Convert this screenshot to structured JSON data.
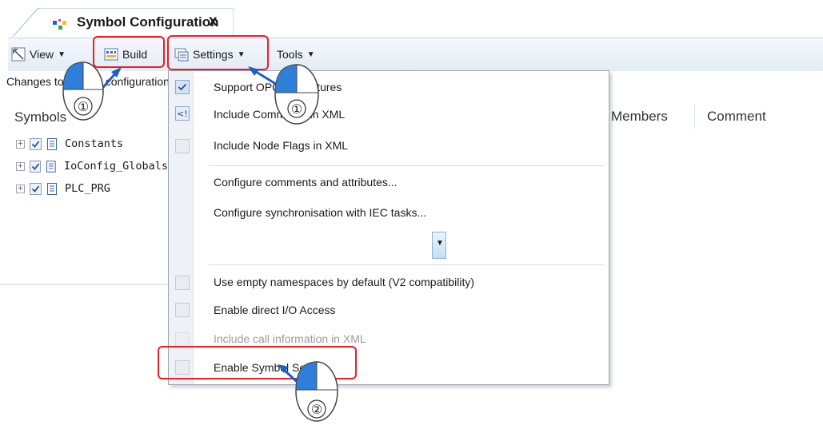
{
  "tab": {
    "title": "Symbol Configuration",
    "close": "x"
  },
  "toolbar": {
    "view_label": "View",
    "build_label": "Build",
    "settings_label": "Settings",
    "tools_label": "Tools"
  },
  "status": {
    "text": "Changes to symbol configuration"
  },
  "columns": {
    "symbols": "Symbols",
    "members": "Members",
    "comment": "Comment"
  },
  "tree": [
    {
      "label": "Constants"
    },
    {
      "label": "IoConfig_Globals"
    },
    {
      "label": "PLC_PRG"
    }
  ],
  "menu": {
    "items": [
      {
        "label": "Support OPC UA features",
        "checked": true
      },
      {
        "label": "Include Comments in XML",
        "checked": true
      },
      {
        "label": "Include Node Flags in XML",
        "checked": false
      },
      {
        "label": "Configure comments and attributes..."
      },
      {
        "label": "Configure synchronisation with IEC tasks..."
      },
      {
        "label": "Use empty namespaces by default (V2 compatibility)",
        "checked": false
      },
      {
        "label": "Enable direct I/O Access",
        "checked": false
      },
      {
        "label": "Include call information in XML",
        "checked": false,
        "disabled": true
      },
      {
        "label": "Enable Symbol Sets",
        "checked": false
      }
    ]
  },
  "callouts": [
    {
      "number": "①"
    },
    {
      "number": "①"
    },
    {
      "number": "②"
    }
  ],
  "colors": {
    "highlight": "#e8202a",
    "callout_arrow": "#1e5fc8",
    "callout_fill": "#2f7ed8"
  }
}
